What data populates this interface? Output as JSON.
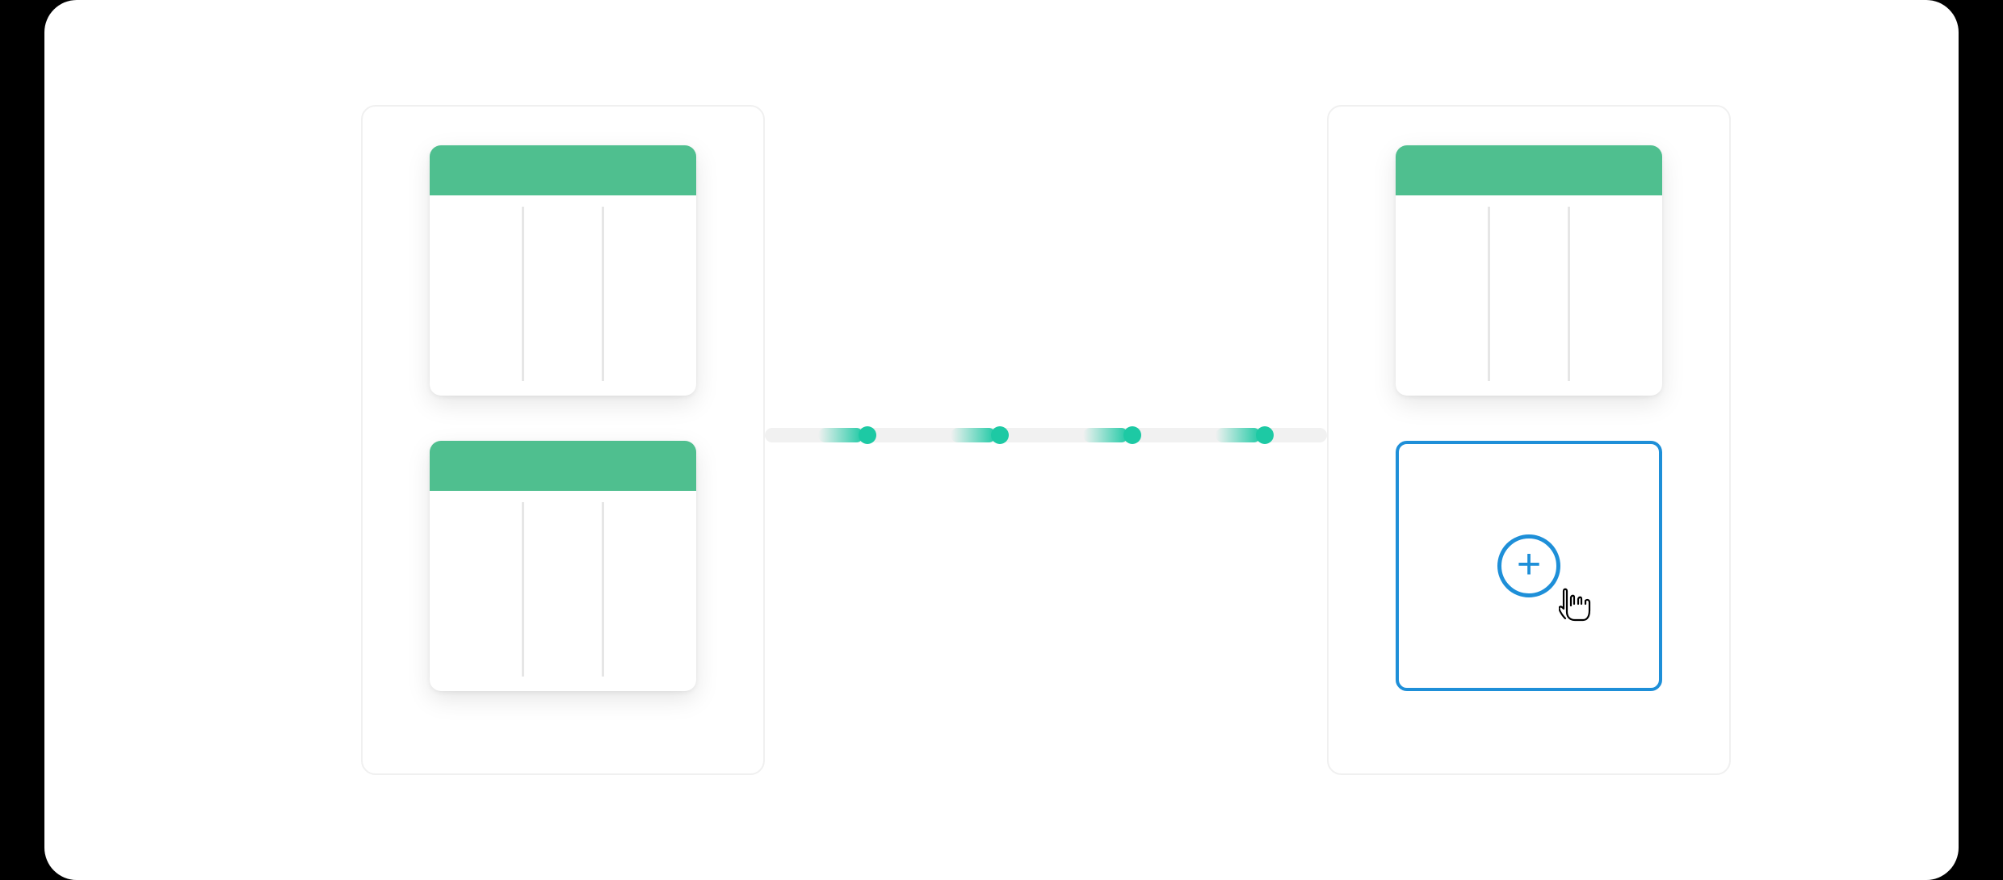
{
  "colors": {
    "table_header": "#4fbf8f",
    "add_border": "#1e8fd8",
    "add_plus": "#1e8fd8",
    "connector_dot": "#1dc9a4",
    "panel_border": "#f0f0f0",
    "column_divider": "#e6e6e6"
  },
  "left_panel": {
    "tables": [
      {
        "columns": 3
      },
      {
        "columns": 3
      }
    ]
  },
  "right_panel": {
    "tables": [
      {
        "columns": 3
      }
    ],
    "add_slot": true
  },
  "connector": {
    "dots": 4
  }
}
